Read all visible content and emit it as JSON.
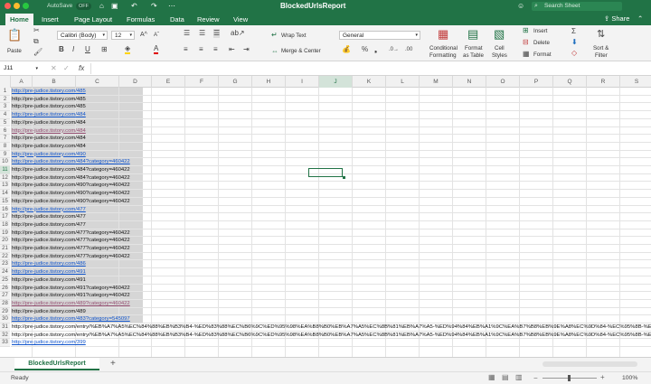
{
  "window": {
    "title": "BlockedUrlsReport",
    "autosave_label": "AutoSave",
    "autosave_state": "OFF",
    "search_placeholder": "Search Sheet"
  },
  "tabs": [
    "Home",
    "Insert",
    "Page Layout",
    "Formulas",
    "Data",
    "Review",
    "View"
  ],
  "active_tab": "Home",
  "share_label": "Share",
  "ribbon": {
    "paste": "Paste",
    "font_name": "Calibri (Body)",
    "font_size": "12",
    "wrap_text": "Wrap Text",
    "merge_center": "Merge & Center",
    "number_format": "General",
    "conditional_formatting": [
      "Conditional",
      "Formatting"
    ],
    "format_as_table": [
      "Format",
      "as Table"
    ],
    "cell_styles": [
      "Cell",
      "Styles"
    ],
    "insert": "Insert",
    "delete": "Delete",
    "format": "Format",
    "sort_filter": [
      "Sort &",
      "Filter"
    ]
  },
  "formula_bar": {
    "name_box": "J11",
    "fx": "fx",
    "value": ""
  },
  "columns": [
    "A",
    "B",
    "C",
    "D",
    "E",
    "F",
    "G",
    "H",
    "I",
    "J",
    "K",
    "L",
    "M",
    "N",
    "O",
    "P",
    "Q",
    "R",
    "S"
  ],
  "selected_column": "J",
  "selected_row": "11",
  "rows": [
    {
      "n": "1",
      "text": "http://pre-judice.tistory.com/485",
      "style": "link"
    },
    {
      "n": "2",
      "text": "http://pre-judice.tistory.com/485",
      "style": "plain"
    },
    {
      "n": "3",
      "text": "http://pre-judice.tistory.com/485",
      "style": "plain"
    },
    {
      "n": "4",
      "text": "http://pre-judice.tistory.com/484",
      "style": "link"
    },
    {
      "n": "5",
      "text": "http://pre-judice.tistory.com/484",
      "style": "plain"
    },
    {
      "n": "6",
      "text": "http://pre-judice.tistory.com/484",
      "style": "visited"
    },
    {
      "n": "7",
      "text": "http://pre-judice.tistory.com/484",
      "style": "plain"
    },
    {
      "n": "8",
      "text": "http://pre-judice.tistory.com/484",
      "style": "plain"
    },
    {
      "n": "9",
      "text": "http://pre-judice.tistory.com/490",
      "style": "link"
    },
    {
      "n": "10",
      "text": "http://pre-judice.tistory.com/484?category=460422",
      "style": "link"
    },
    {
      "n": "11",
      "text": "http://pre-judice.tistory.com/484?category=460422",
      "style": "plain"
    },
    {
      "n": "12",
      "text": "http://pre-judice.tistory.com/484?category=460422",
      "style": "plain"
    },
    {
      "n": "13",
      "text": "http://pre-judice.tistory.com/490?category=460422",
      "style": "plain"
    },
    {
      "n": "14",
      "text": "http://pre-judice.tistory.com/490?category=460422",
      "style": "plain"
    },
    {
      "n": "15",
      "text": "http://pre-judice.tistory.com/490?category=460422",
      "style": "plain"
    },
    {
      "n": "16",
      "text": "http://pre-judice.tistory.com/477",
      "style": "link"
    },
    {
      "n": "17",
      "text": "http://pre-judice.tistory.com/477",
      "style": "plain"
    },
    {
      "n": "18",
      "text": "http://pre-judice.tistory.com/477",
      "style": "plain"
    },
    {
      "n": "19",
      "text": "http://pre-judice.tistory.com/477?category=460422",
      "style": "plain"
    },
    {
      "n": "20",
      "text": "http://pre-judice.tistory.com/477?category=460422",
      "style": "plain"
    },
    {
      "n": "21",
      "text": "http://pre-judice.tistory.com/477?category=460422",
      "style": "plain"
    },
    {
      "n": "22",
      "text": "http://pre-judice.tistory.com/477?category=460422",
      "style": "plain"
    },
    {
      "n": "23",
      "text": "http://pre-judice.tistory.com/486",
      "style": "link"
    },
    {
      "n": "24",
      "text": "http://pre-judice.tistory.com/491",
      "style": "link"
    },
    {
      "n": "25",
      "text": "http://pre-judice.tistory.com/491",
      "style": "plain"
    },
    {
      "n": "26",
      "text": "http://pre-judice.tistory.com/491?category=460422",
      "style": "plain"
    },
    {
      "n": "27",
      "text": "http://pre-judice.tistory.com/491?category=460422",
      "style": "plain"
    },
    {
      "n": "28",
      "text": "http://pre-judice.tistory.com/489?category=460422",
      "style": "visited"
    },
    {
      "n": "29",
      "text": "http://pre-judice.tistory.com/489",
      "style": "plain"
    },
    {
      "n": "30",
      "text": "http://pre-judice.tistory.com/483?category=545097",
      "style": "link"
    },
    {
      "n": "31",
      "text": "http://pre-judice.tistory.com/entry/%EB%A7%A5%EC%84%88%EB%B3%B4-%ED%83%88%EC%B6%9C%ED%95%98%EA%B8%B0%EB%A7%A5%EC%8B%81%EB%A7%A5-%ED%94%84%EB%A1%9C%EA%B7%B8%EB%9E%A8%EC%9D%84-%EC%95%8B-%ED",
      "style": "plain"
    },
    {
      "n": "32",
      "text": "http://pre-judice.tistory.com/entry/%EB%A7%A5%EC%84%88%EB%B3%B4-%ED%83%88%EC%B6%9C%ED%95%98%EA%B8%B0%EB%A7%A5%EC%8B%81%EB%A7%A5-%ED%94%84%EB%A1%9C%EA%B7%B8%EB%9E%A8%EC%9D%84-%EC%95%8B-%ED",
      "style": "plain"
    },
    {
      "n": "33",
      "text": "http://pre-judice.tistory.com/399",
      "style": "link"
    }
  ],
  "sheet_tab": "BlockedUrlsReport",
  "add_sheet": "+",
  "status": {
    "ready": "Ready",
    "zoom": "100%"
  },
  "colors": {
    "brand": "#217346",
    "link": "#1155cc",
    "visited": "#954f72",
    "selection_fill": "#d6d6d6"
  }
}
